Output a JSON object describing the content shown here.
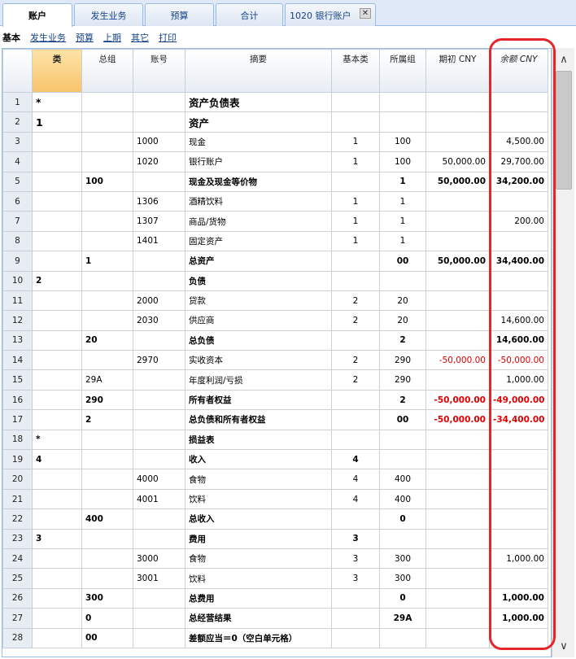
{
  "tabs": [
    {
      "label": "账户"
    },
    {
      "label": "发生业务"
    },
    {
      "label": "预算"
    },
    {
      "label": "合计"
    },
    {
      "label": "1020 银行账户",
      "close": "✕"
    }
  ],
  "subnav": {
    "active": "基本",
    "links": [
      "发生业务",
      "预算",
      "上期",
      "其它",
      "打印"
    ]
  },
  "columns": [
    "",
    "类",
    "总组",
    "账号",
    "摘要",
    "基本类",
    "所属组",
    "期初 CNY",
    "余额 CNY"
  ],
  "rows": [
    {
      "n": "1",
      "cls": "*",
      "grp": "",
      "acct": "",
      "desc": "资产负债表",
      "bc": "",
      "sg": "",
      "open": "",
      "bal": "",
      "style": "big"
    },
    {
      "n": "2",
      "cls": "1",
      "grp": "",
      "acct": "",
      "desc": "资产",
      "bc": "",
      "sg": "",
      "open": "",
      "bal": "",
      "style": "big"
    },
    {
      "n": "3",
      "cls": "",
      "grp": "",
      "acct": "1000",
      "desc": "现金",
      "bc": "1",
      "sg": "100",
      "open": "",
      "bal": "4,500.00"
    },
    {
      "n": "4",
      "cls": "",
      "grp": "",
      "acct": "1020",
      "desc": "银行账户",
      "bc": "1",
      "sg": "100",
      "open": "50,000.00",
      "bal": "29,700.00"
    },
    {
      "n": "5",
      "cls": "",
      "grp": "100",
      "acct": "",
      "desc": "现金及现金等价物",
      "bc": "",
      "sg": "1",
      "open": "50,000.00",
      "bal": "34,200.00",
      "style": "bold"
    },
    {
      "n": "6",
      "cls": "",
      "grp": "",
      "acct": "1306",
      "desc": "酒精饮料",
      "bc": "1",
      "sg": "1",
      "open": "",
      "bal": ""
    },
    {
      "n": "7",
      "cls": "",
      "grp": "",
      "acct": "1307",
      "desc": "商品/货物",
      "bc": "1",
      "sg": "1",
      "open": "",
      "bal": "200.00"
    },
    {
      "n": "8",
      "cls": "",
      "grp": "",
      "acct": "1401",
      "desc": "固定资产",
      "bc": "1",
      "sg": "1",
      "open": "",
      "bal": ""
    },
    {
      "n": "9",
      "cls": "",
      "grp": "1",
      "acct": "",
      "desc": "总资产",
      "bc": "",
      "sg": "00",
      "open": "50,000.00",
      "bal": "34,400.00",
      "style": "bold"
    },
    {
      "n": "10",
      "cls": "2",
      "grp": "",
      "acct": "",
      "desc": "负债",
      "bc": "",
      "sg": "",
      "open": "",
      "bal": "",
      "style": "bold"
    },
    {
      "n": "11",
      "cls": "",
      "grp": "",
      "acct": "2000",
      "desc": "贷款",
      "bc": "2",
      "sg": "20",
      "open": "",
      "bal": ""
    },
    {
      "n": "12",
      "cls": "",
      "grp": "",
      "acct": "2030",
      "desc": "供应商",
      "bc": "2",
      "sg": "20",
      "open": "",
      "bal": "14,600.00"
    },
    {
      "n": "13",
      "cls": "",
      "grp": "20",
      "acct": "",
      "desc": "总负债",
      "bc": "",
      "sg": "2",
      "open": "",
      "bal": "14,600.00",
      "style": "bold"
    },
    {
      "n": "14",
      "cls": "",
      "grp": "",
      "acct": "2970",
      "desc": "实收资本",
      "bc": "2",
      "sg": "290",
      "open": "-50,000.00",
      "bal": "-50,000.00",
      "neg": true
    },
    {
      "n": "15",
      "cls": "",
      "grp": "29A",
      "acct": "",
      "desc": "年度利润/亏损",
      "bc": "2",
      "sg": "290",
      "open": "",
      "bal": "1,000.00"
    },
    {
      "n": "16",
      "cls": "",
      "grp": "290",
      "acct": "",
      "desc": "所有者权益",
      "bc": "",
      "sg": "2",
      "open": "-50,000.00",
      "bal": "-49,000.00",
      "style": "bold",
      "neg": true
    },
    {
      "n": "17",
      "cls": "",
      "grp": "2",
      "acct": "",
      "desc": "总负债和所有者权益",
      "bc": "",
      "sg": "00",
      "open": "-50,000.00",
      "bal": "-34,400.00",
      "style": "bold",
      "neg": true
    },
    {
      "n": "18",
      "cls": "*",
      "grp": "",
      "acct": "",
      "desc": "损益表",
      "bc": "",
      "sg": "",
      "open": "",
      "bal": "",
      "style": "bold"
    },
    {
      "n": "19",
      "cls": "4",
      "grp": "",
      "acct": "",
      "desc": "收入",
      "bc": "4",
      "sg": "",
      "open": "",
      "bal": "",
      "style": "bold"
    },
    {
      "n": "20",
      "cls": "",
      "grp": "",
      "acct": "4000",
      "desc": "食物",
      "bc": "4",
      "sg": "400",
      "open": "",
      "bal": ""
    },
    {
      "n": "21",
      "cls": "",
      "grp": "",
      "acct": "4001",
      "desc": "饮料",
      "bc": "4",
      "sg": "400",
      "open": "",
      "bal": ""
    },
    {
      "n": "22",
      "cls": "",
      "grp": "400",
      "acct": "",
      "desc": "总收入",
      "bc": "",
      "sg": "0",
      "open": "",
      "bal": "",
      "style": "bold"
    },
    {
      "n": "23",
      "cls": "3",
      "grp": "",
      "acct": "",
      "desc": "费用",
      "bc": "3",
      "sg": "",
      "open": "",
      "bal": "",
      "style": "bold"
    },
    {
      "n": "24",
      "cls": "",
      "grp": "",
      "acct": "3000",
      "desc": "食物",
      "bc": "3",
      "sg": "300",
      "open": "",
      "bal": "1,000.00"
    },
    {
      "n": "25",
      "cls": "",
      "grp": "",
      "acct": "3001",
      "desc": "饮料",
      "bc": "3",
      "sg": "300",
      "open": "",
      "bal": ""
    },
    {
      "n": "26",
      "cls": "",
      "grp": "300",
      "acct": "",
      "desc": "总费用",
      "bc": "",
      "sg": "0",
      "open": "",
      "bal": "1,000.00",
      "style": "bold"
    },
    {
      "n": "27",
      "cls": "",
      "grp": "0",
      "acct": "",
      "desc": "总经营结果",
      "bc": "",
      "sg": "29A",
      "open": "",
      "bal": "1,000.00",
      "style": "bold"
    },
    {
      "n": "28",
      "cls": "",
      "grp": "00",
      "acct": "",
      "desc": "差额应当＝0（空白单元格）",
      "bc": "",
      "sg": "",
      "open": "",
      "bal": "",
      "style": "bold"
    }
  ],
  "scrollbar": {
    "up": "∧",
    "down": "∨"
  },
  "colors": {
    "negative": "#e00000",
    "highlight": "#e4262b",
    "header_selected": "#f7c46b"
  }
}
